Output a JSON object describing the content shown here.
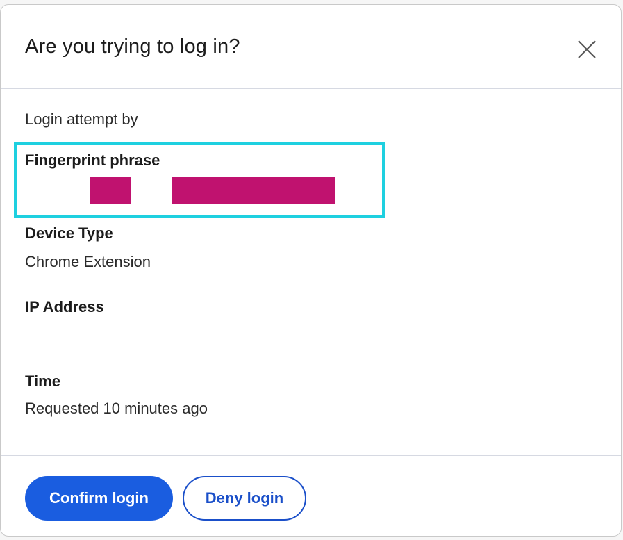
{
  "dialog": {
    "title": "Are you trying to log in?",
    "close_icon": "close-icon"
  },
  "details": {
    "intro": "Login attempt by",
    "fingerprint_label": "Fingerprint phrase",
    "device_type_label": "Device Type",
    "device_type_value": "Chrome Extension",
    "ip_address_label": "IP Address",
    "time_label": "Time",
    "time_value": "Requested 10 minutes ago"
  },
  "actions": {
    "confirm_label": "Confirm login",
    "deny_label": "Deny login"
  },
  "colors": {
    "primary": "#1a5de0",
    "highlight": "#1ed0e0",
    "redaction": "#c0126f"
  }
}
